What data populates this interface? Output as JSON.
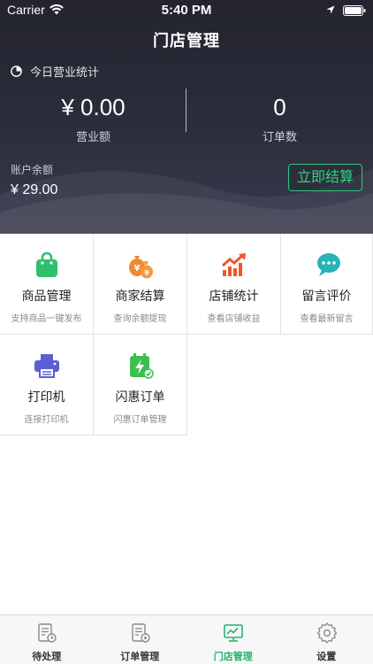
{
  "status_bar": {
    "carrier": "Carrier",
    "time": "5:40 PM"
  },
  "header": {
    "title": "门店管理"
  },
  "stats": {
    "label": "今日营业统计",
    "revenue_value": "¥ 0.00",
    "revenue_label": "营业额",
    "orders_value": "0",
    "orders_label": "订单数"
  },
  "account": {
    "balance_label": "账户余额",
    "balance_value": "¥ 29.00",
    "settle_button": "立即结算"
  },
  "grid": [
    {
      "name": "商品管理",
      "desc": "支持商品一键发布",
      "icon": "shopping-bag-icon",
      "color": "#2fc06e"
    },
    {
      "name": "商家结算",
      "desc": "查询余额提现",
      "icon": "money-bags-icon",
      "color": "#f08a2c"
    },
    {
      "name": "店铺统计",
      "desc": "查看店铺收益",
      "icon": "trend-chart-icon",
      "color": "#f0562a"
    },
    {
      "name": "留言评价",
      "desc": "查看最新留言",
      "icon": "chat-bubbles-icon",
      "color": "#27b3b8"
    },
    {
      "name": "打印机",
      "desc": "连接打印机",
      "icon": "printer-icon",
      "color": "#5b5fd6"
    },
    {
      "name": "闪惠订单",
      "desc": "闪惠订单管理",
      "icon": "flash-calendar-icon",
      "color": "#3cbf4f"
    }
  ],
  "tabs": [
    {
      "label": "待处理",
      "icon": "pending-document-icon",
      "active": false
    },
    {
      "label": "订单管理",
      "icon": "order-document-icon",
      "active": false
    },
    {
      "label": "门店管理",
      "icon": "store-monitor-icon",
      "active": true
    },
    {
      "label": "设置",
      "icon": "settings-gear-icon",
      "active": false
    }
  ],
  "colors": {
    "accent": "#23b46e",
    "header_bg": "#262835",
    "settle_border": "#2ec87a"
  }
}
